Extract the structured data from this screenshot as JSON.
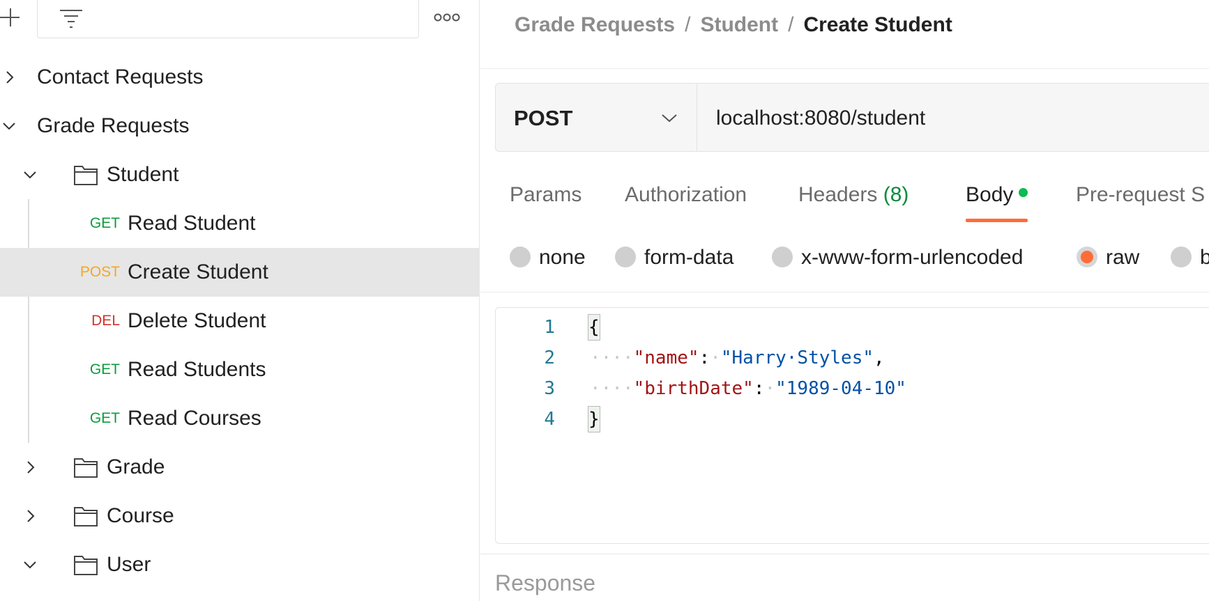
{
  "sidebar": {
    "tree": [
      {
        "id": "contact",
        "label": "Contact Requests",
        "expanded": false
      },
      {
        "id": "grade-requests",
        "label": "Grade Requests",
        "expanded": true
      },
      {
        "id": "student",
        "label": "Student",
        "expanded": true
      },
      {
        "id": "read-student",
        "method": "GET",
        "label": "Read Student"
      },
      {
        "id": "create-student",
        "method": "POST",
        "label": "Create Student",
        "selected": true
      },
      {
        "id": "delete-student",
        "method": "DEL",
        "label": "Delete Student"
      },
      {
        "id": "read-students",
        "method": "GET",
        "label": "Read Students"
      },
      {
        "id": "read-courses",
        "method": "GET",
        "label": "Read Courses"
      },
      {
        "id": "grade",
        "label": "Grade",
        "expanded": false
      },
      {
        "id": "course",
        "label": "Course",
        "expanded": false
      },
      {
        "id": "user",
        "label": "User",
        "expanded": true
      }
    ]
  },
  "breadcrumb": {
    "parts": [
      "Grade Requests",
      "Student"
    ],
    "current": "Create Student",
    "separator": "/"
  },
  "request": {
    "method": "POST",
    "url": "localhost:8080/student"
  },
  "tabs": {
    "params": "Params",
    "authorization": "Authorization",
    "headers": "Headers",
    "headers_count": "(8)",
    "body": "Body",
    "prerequest": "Pre-request S"
  },
  "body_types": {
    "none": "none",
    "form_data": "form-data",
    "urlencoded": "x-www-form-urlencoded",
    "raw": "raw",
    "binary": "b",
    "selected": "raw"
  },
  "editor": {
    "lines": [
      {
        "num": "1"
      },
      {
        "num": "2",
        "key": "\"name\"",
        "value": "\"Harry·Styles\""
      },
      {
        "num": "3",
        "key": "\"birthDate\"",
        "value": "\"1989-04-10\""
      },
      {
        "num": "4"
      }
    ],
    "open_brace": "{",
    "close_brace": "}"
  },
  "response": {
    "label": "Response"
  },
  "colors": {
    "accent": "#ff6c37",
    "get": "#0a9c3b",
    "post": "#f5a623",
    "del": "#d0342c"
  }
}
